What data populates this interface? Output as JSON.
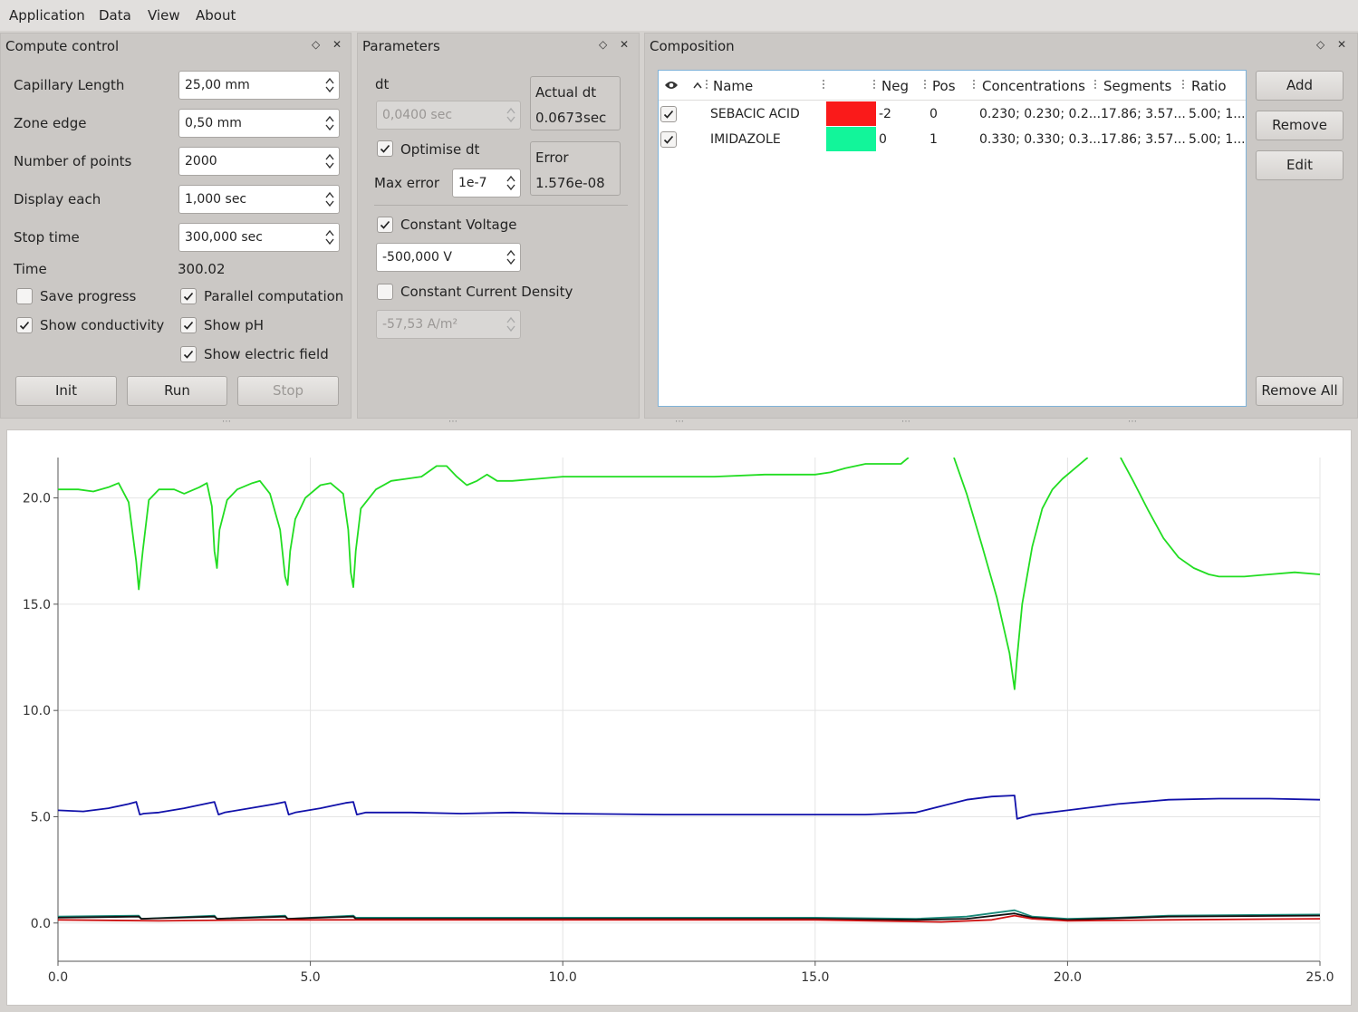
{
  "menu": [
    "Application",
    "Data",
    "View",
    "About"
  ],
  "compute": {
    "title": "Compute control",
    "fields": [
      {
        "label": "Capillary Length",
        "value": "25,00 mm"
      },
      {
        "label": "Zone edge",
        "value": "0,50 mm"
      },
      {
        "label": "Number of points",
        "value": "2000"
      },
      {
        "label": "Display each",
        "value": "1,000 sec"
      },
      {
        "label": "Stop time",
        "value": "300,000 sec"
      }
    ],
    "time_label": "Time",
    "time_value": "300.02",
    "checks": [
      {
        "label": "Save progress",
        "checked": false
      },
      {
        "label": "Parallel computation",
        "checked": true
      },
      {
        "label": "Show conductivity",
        "checked": true
      },
      {
        "label": "Show pH",
        "checked": true
      },
      {
        "label": "Show electric field",
        "checked": true
      }
    ],
    "buttons": [
      {
        "label": "Init",
        "enabled": true
      },
      {
        "label": "Run",
        "enabled": true
      },
      {
        "label": "Stop",
        "enabled": false
      }
    ]
  },
  "params": {
    "title": "Parameters",
    "dt_label": "dt",
    "dt_value": "0,0400 sec",
    "actual_dt_label": "Actual dt",
    "actual_dt_value": "0.0673",
    "actual_dt_unit": "sec",
    "optimise_label": "Optimise dt",
    "optimise_checked": true,
    "max_error_label": "Max error",
    "max_error_value": "1e-7",
    "error_label": "Error",
    "error_value": "1.576e-08",
    "const_voltage_label": "Constant Voltage",
    "const_voltage_checked": true,
    "voltage_value": "-500,000 V",
    "const_current_label": "Constant Current Density",
    "const_current_checked": false,
    "current_value": "-57,53 A/m²"
  },
  "composition": {
    "title": "Composition",
    "columns": [
      "Name",
      "Neg",
      "Pos",
      "Concentrations",
      "Segments",
      "Ratio"
    ],
    "rows": [
      {
        "checked": true,
        "name": "SEBACIC ACID",
        "color": "#fa1a1a",
        "neg": "-2",
        "pos": "0",
        "conc": "0.230; 0.230; 0.2...",
        "segments": "17.86; 3.57...",
        "ratio": "5.00; 1..."
      },
      {
        "checked": true,
        "name": "IMIDAZOLE",
        "color": "#12f59a",
        "neg": "0",
        "pos": "1",
        "conc": "0.330; 0.330; 0.3...",
        "segments": "17.86; 3.57...",
        "ratio": "5.00; 1..."
      }
    ],
    "buttons": {
      "add": "Add",
      "remove": "Remove",
      "edit": "Edit",
      "remove_all": "Remove All"
    }
  },
  "chart_data": {
    "type": "line",
    "xlim": [
      0,
      25
    ],
    "ylim": [
      -1.8,
      21.9
    ],
    "x_ticks": [
      "0.0",
      "5.0",
      "10.0",
      "15.0",
      "20.0",
      "25.0"
    ],
    "y_ticks": [
      "0.0",
      "5.0",
      "10.0",
      "15.0",
      "20.0"
    ],
    "grid": true,
    "series": [
      {
        "color": "#22dd22",
        "points": [
          [
            0,
            20.4
          ],
          [
            0.4,
            20.4
          ],
          [
            0.7,
            20.3
          ],
          [
            1.0,
            20.5
          ],
          [
            1.2,
            20.7
          ],
          [
            1.4,
            19.8
          ],
          [
            1.55,
            17.0
          ],
          [
            1.6,
            15.7
          ],
          [
            1.68,
            17.5
          ],
          [
            1.8,
            19.9
          ],
          [
            2.0,
            20.4
          ],
          [
            2.3,
            20.4
          ],
          [
            2.5,
            20.2
          ],
          [
            2.8,
            20.5
          ],
          [
            2.95,
            20.7
          ],
          [
            3.05,
            19.6
          ],
          [
            3.1,
            17.5
          ],
          [
            3.15,
            16.7
          ],
          [
            3.2,
            18.5
          ],
          [
            3.35,
            19.9
          ],
          [
            3.55,
            20.4
          ],
          [
            3.85,
            20.7
          ],
          [
            4.0,
            20.8
          ],
          [
            4.2,
            20.2
          ],
          [
            4.4,
            18.5
          ],
          [
            4.5,
            16.3
          ],
          [
            4.55,
            15.9
          ],
          [
            4.6,
            17.5
          ],
          [
            4.7,
            19.0
          ],
          [
            4.9,
            20.0
          ],
          [
            5.2,
            20.6
          ],
          [
            5.4,
            20.7
          ],
          [
            5.65,
            20.2
          ],
          [
            5.75,
            18.5
          ],
          [
            5.8,
            16.5
          ],
          [
            5.85,
            15.8
          ],
          [
            5.9,
            17.5
          ],
          [
            6.0,
            19.5
          ],
          [
            6.3,
            20.4
          ],
          [
            6.6,
            20.8
          ],
          [
            6.9,
            20.9
          ],
          [
            7.2,
            21.0
          ],
          [
            7.5,
            21.5
          ],
          [
            7.7,
            21.5
          ],
          [
            7.9,
            21.0
          ],
          [
            8.1,
            20.6
          ],
          [
            8.3,
            20.8
          ],
          [
            8.5,
            21.1
          ],
          [
            8.7,
            20.8
          ],
          [
            9.0,
            20.8
          ],
          [
            9.5,
            20.9
          ],
          [
            10,
            21.0
          ],
          [
            11,
            21.0
          ],
          [
            12,
            21.0
          ],
          [
            13,
            21.0
          ],
          [
            14,
            21.1
          ],
          [
            15,
            21.1
          ],
          [
            15.3,
            21.2
          ],
          [
            15.6,
            21.4
          ],
          [
            16,
            21.6
          ],
          [
            16.4,
            21.6
          ],
          [
            16.7,
            21.6
          ],
          [
            16.85,
            21.9
          ]
        ]
      },
      {
        "color": "#22dd22",
        "points": [
          [
            17.75,
            21.9
          ],
          [
            18.0,
            20.2
          ],
          [
            18.3,
            17.8
          ],
          [
            18.6,
            15.3
          ],
          [
            18.85,
            12.7
          ],
          [
            18.95,
            11.0
          ],
          [
            19.0,
            12.5
          ],
          [
            19.1,
            15.0
          ],
          [
            19.3,
            17.7
          ],
          [
            19.5,
            19.5
          ],
          [
            19.7,
            20.4
          ],
          [
            19.9,
            20.9
          ],
          [
            20.1,
            21.3
          ],
          [
            20.3,
            21.7
          ],
          [
            20.4,
            21.9
          ]
        ]
      },
      {
        "color": "#22dd22",
        "points": [
          [
            21.05,
            21.9
          ],
          [
            21.3,
            20.8
          ],
          [
            21.6,
            19.4
          ],
          [
            21.9,
            18.1
          ],
          [
            22.2,
            17.2
          ],
          [
            22.5,
            16.7
          ],
          [
            22.8,
            16.4
          ],
          [
            23.0,
            16.3
          ],
          [
            23.5,
            16.3
          ],
          [
            24.0,
            16.4
          ],
          [
            24.5,
            16.5
          ],
          [
            25.0,
            16.4
          ]
        ]
      },
      {
        "color": "#1111aa",
        "points": [
          [
            0,
            5.3
          ],
          [
            0.5,
            5.25
          ],
          [
            1.0,
            5.4
          ],
          [
            1.4,
            5.6
          ],
          [
            1.55,
            5.7
          ],
          [
            1.62,
            5.1
          ],
          [
            1.7,
            5.15
          ],
          [
            2.0,
            5.2
          ],
          [
            2.5,
            5.4
          ],
          [
            3.0,
            5.65
          ],
          [
            3.1,
            5.7
          ],
          [
            3.18,
            5.1
          ],
          [
            3.3,
            5.2
          ],
          [
            3.8,
            5.4
          ],
          [
            4.3,
            5.6
          ],
          [
            4.5,
            5.7
          ],
          [
            4.57,
            5.1
          ],
          [
            4.7,
            5.2
          ],
          [
            5.2,
            5.4
          ],
          [
            5.7,
            5.65
          ],
          [
            5.85,
            5.7
          ],
          [
            5.92,
            5.1
          ],
          [
            6.1,
            5.2
          ],
          [
            7.0,
            5.2
          ],
          [
            8.0,
            5.15
          ],
          [
            9.0,
            5.2
          ],
          [
            10,
            5.15
          ],
          [
            12,
            5.1
          ],
          [
            14,
            5.1
          ],
          [
            15,
            5.1
          ],
          [
            16,
            5.1
          ],
          [
            17,
            5.2
          ],
          [
            17.5,
            5.5
          ],
          [
            18,
            5.8
          ],
          [
            18.5,
            5.95
          ],
          [
            18.95,
            6.0
          ],
          [
            19.0,
            4.9
          ],
          [
            19.3,
            5.1
          ],
          [
            20.0,
            5.3
          ],
          [
            21,
            5.6
          ],
          [
            22,
            5.8
          ],
          [
            23,
            5.85
          ],
          [
            24,
            5.85
          ],
          [
            25,
            5.8
          ]
        ]
      },
      {
        "color": "#1a8a7a",
        "points": [
          [
            0,
            0.3
          ],
          [
            1.6,
            0.35
          ],
          [
            1.65,
            0.2
          ],
          [
            3.1,
            0.35
          ],
          [
            3.15,
            0.2
          ],
          [
            4.5,
            0.35
          ],
          [
            4.55,
            0.2
          ],
          [
            5.85,
            0.35
          ],
          [
            5.9,
            0.25
          ],
          [
            10,
            0.25
          ],
          [
            15,
            0.25
          ],
          [
            17,
            0.2
          ],
          [
            18,
            0.3
          ],
          [
            18.95,
            0.6
          ],
          [
            19.3,
            0.3
          ],
          [
            20,
            0.2
          ],
          [
            21,
            0.25
          ],
          [
            22,
            0.35
          ],
          [
            25,
            0.4
          ]
        ]
      },
      {
        "color": "#111111",
        "points": [
          [
            0,
            0.25
          ],
          [
            1.6,
            0.3
          ],
          [
            1.65,
            0.2
          ],
          [
            3.1,
            0.3
          ],
          [
            3.15,
            0.2
          ],
          [
            4.5,
            0.3
          ],
          [
            4.55,
            0.2
          ],
          [
            5.85,
            0.3
          ],
          [
            5.9,
            0.2
          ],
          [
            10,
            0.2
          ],
          [
            15,
            0.2
          ],
          [
            17,
            0.15
          ],
          [
            18,
            0.2
          ],
          [
            18.95,
            0.45
          ],
          [
            19.3,
            0.25
          ],
          [
            20,
            0.15
          ],
          [
            22,
            0.3
          ],
          [
            25,
            0.35
          ]
        ]
      },
      {
        "color": "#cc1111",
        "points": [
          [
            0,
            0.15
          ],
          [
            2,
            0.1
          ],
          [
            4,
            0.15
          ],
          [
            6,
            0.15
          ],
          [
            10,
            0.15
          ],
          [
            15,
            0.15
          ],
          [
            17.5,
            0.05
          ],
          [
            18.5,
            0.15
          ],
          [
            18.95,
            0.35
          ],
          [
            19.3,
            0.2
          ],
          [
            20,
            0.1
          ],
          [
            22,
            0.15
          ],
          [
            25,
            0.2
          ]
        ]
      }
    ]
  }
}
